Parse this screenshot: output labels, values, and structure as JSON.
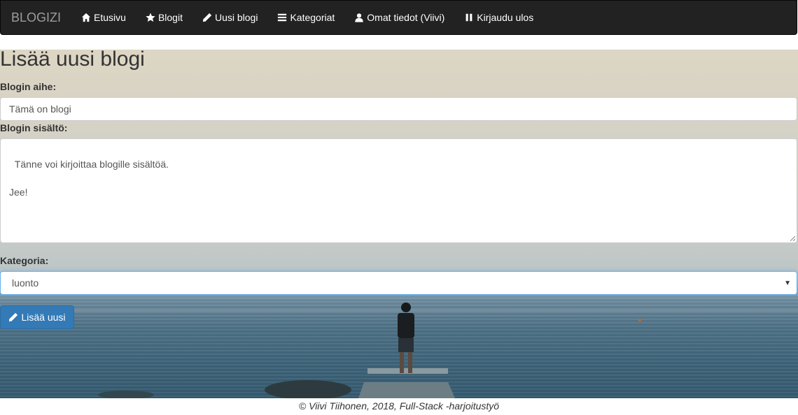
{
  "navbar": {
    "brand": "BLOGIZI",
    "items": [
      {
        "label": "Etusivu",
        "icon": "home-icon"
      },
      {
        "label": "Blogit",
        "icon": "star-icon"
      },
      {
        "label": "Uusi blogi",
        "icon": "pencil-icon"
      },
      {
        "label": "Kategoriat",
        "icon": "list-icon"
      },
      {
        "label": "Omat tiedot (Viivi)",
        "icon": "user-icon"
      },
      {
        "label": "Kirjaudu ulos",
        "icon": "pause-icon"
      }
    ]
  },
  "form": {
    "title": "Lisää uusi blogi",
    "topic_label": "Blogin aihe:",
    "topic_value": "Tämä on blogi",
    "content_label": "Blogin sisältö:",
    "content_value": "Tänne voi kirjoittaa blogille sisältöä.\n\nJee!",
    "category_label": "Kategoria:",
    "category_value": "luonto",
    "submit_label": "Lisää uusi"
  },
  "footer": {
    "text": "© Viivi Tiihonen, 2018, Full-Stack -harjoitustyö"
  },
  "colors": {
    "navbar_bg": "#222222",
    "brand": "#9d9d9d",
    "primary_button": "#337ab7",
    "select_focus": "#66afe9"
  }
}
